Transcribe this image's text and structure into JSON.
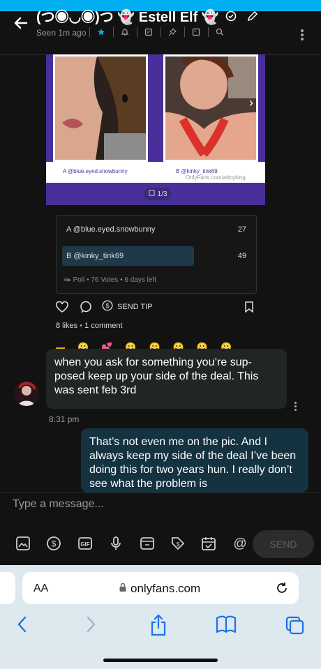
{
  "header": {
    "title": "(つ◉◡◉)つ 👻 Estell Elf 👻",
    "seen": "Seen 1m ago"
  },
  "post": {
    "caption_a": "A @blue.eyed.snowbunny",
    "caption_b": "B @kinky_tink69",
    "watermark_b": "OnlyFans.com/abbyking",
    "image_counter": "1/3"
  },
  "poll": {
    "options": [
      {
        "label": "A @blue.eyed.snowbunny",
        "votes": "27",
        "share": 0.36
      },
      {
        "label": "B @kinky_tink69",
        "votes": "49",
        "share": 0.64
      }
    ],
    "meta": "Poll • 76 Votes • 6 days left"
  },
  "actions": {
    "send_tip": "SEND TIP",
    "likes": "8 likes",
    "comments": "1 comment"
  },
  "messages": [
    {
      "text": "when you ask for something you’re sup-posed keep up your side of the deal. This was sent feb 3rd",
      "time": "8:31 pm"
    },
    {
      "text": "That’s not even me on the pic. And I always keep my side of the deal I’ve been doing this for two years hun. I really don’t see what the problem is"
    }
  ],
  "composer": {
    "placeholder": "Type a message...",
    "send_label": "SEND"
  },
  "browser": {
    "aa": "AA",
    "url": "onlyfans.com"
  },
  "colors": {
    "accent": "#00aff0",
    "post_frame": "#4a2f9a",
    "poll_bar": "#1e3a4a",
    "incoming_bubble": "#222526",
    "outgoing_bubble": "#143240"
  }
}
